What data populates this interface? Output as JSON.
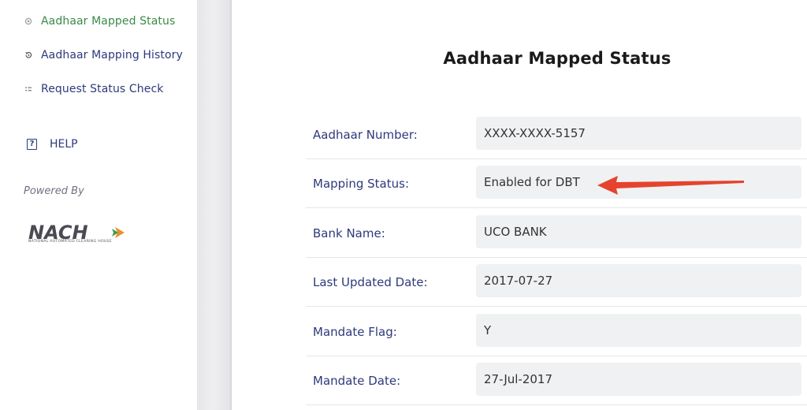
{
  "sidebar": {
    "items": [
      {
        "label": "Aadhaar Mapped Status",
        "icon": "radio-dot-icon",
        "active": true
      },
      {
        "label": "Aadhaar Mapping History",
        "icon": "history-icon",
        "active": false
      },
      {
        "label": "Request Status Check",
        "icon": "list-icon",
        "active": false
      }
    ],
    "help_label": "HELP",
    "powered_by": "Powered By",
    "logo_text": "NACH",
    "logo_subtext": "NATIONAL AUTOMATED CLEARING HOUSE"
  },
  "main": {
    "title": "Aadhaar Mapped Status",
    "rows": [
      {
        "label": "Aadhaar Number:",
        "value": "XXXX-XXXX-5157"
      },
      {
        "label": "Mapping Status:",
        "value": "Enabled for DBT"
      },
      {
        "label": "Bank Name:",
        "value": "UCO BANK"
      },
      {
        "label": "Last Updated Date:",
        "value": "2017-07-27"
      },
      {
        "label": "Mandate Flag:",
        "value": "Y"
      },
      {
        "label": "Mandate Date:",
        "value": "27-Jul-2017"
      }
    ]
  },
  "colors": {
    "nav_text": "#2d3a7a",
    "active_nav": "#3a8a4a",
    "value_bg": "#f0f1f3",
    "arrow": "#e5432d"
  }
}
